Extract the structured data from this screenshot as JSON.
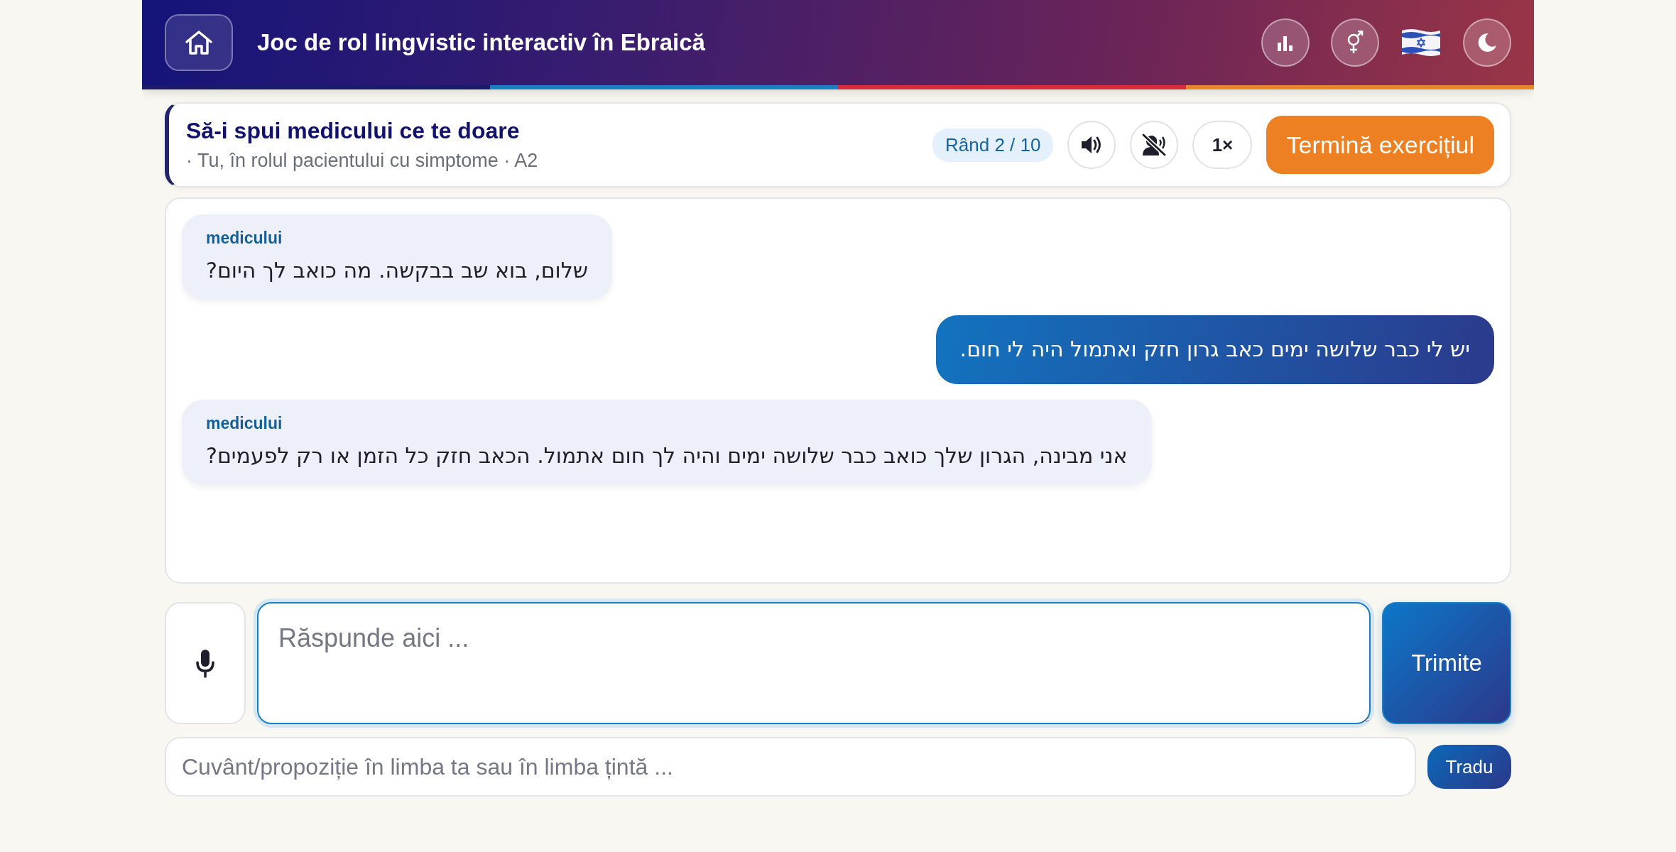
{
  "header": {
    "title": "Joc de rol lingvistic interactiv în Ebraică"
  },
  "exercise": {
    "title": "Să-i spui medicului ce te doare",
    "subtitle": "· Tu, în rolul pacientului cu simptome · A2",
    "round": "Rând 2 / 10",
    "speed": "1×",
    "finish_button": "Termină exercițiul"
  },
  "messages": [
    {
      "kind": "bot",
      "speaker": "medicului",
      "text": "שלום, בוא שב בבקשה. מה כואב לך היום?"
    },
    {
      "kind": "user",
      "text": "יש לי כבר שלושה ימים כאב גרון חזק ואתמול היה לי חום."
    },
    {
      "kind": "bot",
      "speaker": "medicului",
      "text": "אני מבינה, הגרון שלך כואב כבר שלושה ימים והיה לך חום אתמול. הכאב חזק כל הזמן או רק לפעמים?"
    }
  ],
  "composer": {
    "placeholder": "Răspunde aici ...",
    "send_button": "Trimite"
  },
  "translator": {
    "placeholder": "Cuvânt/propoziție în limba ta sau în limba țintă ...",
    "button": "Tradu"
  }
}
